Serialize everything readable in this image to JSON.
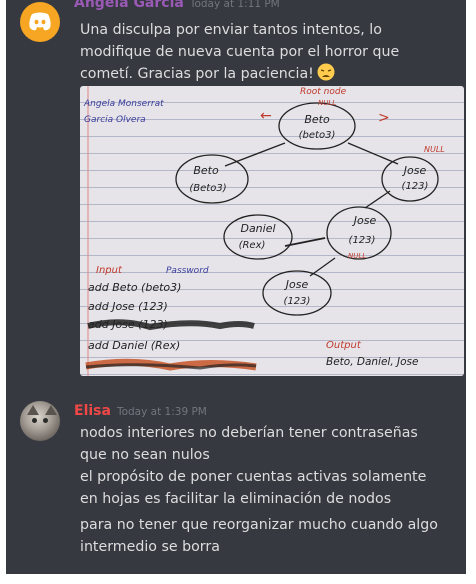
{
  "messages": [
    {
      "author": "Angela Garcia",
      "author_color": "#9b59b6",
      "timestamp": "Today at 1:11 PM",
      "lines": [
        "Una disculpa por enviar tantos intentos, lo",
        "modifique de nueva cuenta por el horror que",
        "cometí.   Gracias por la paciencia!"
      ],
      "emoji": "weary-face-emoji",
      "avatar": "discord-logo-icon",
      "attachment": {
        "notes_top_left": [
          "Angela Monserrat",
          "Garcia Olvera"
        ],
        "root_note": [
          "Root node",
          "NULL"
        ],
        "arrow_left": "←",
        "arrow_right": ">",
        "null_right": "NULL",
        "null_jose": "NULL",
        "nodes": [
          {
            "name": "Beto",
            "pass": "(beto3)"
          },
          {
            "name": "Beto",
            "pass": "(Beto3)"
          },
          {
            "name": "Jose",
            "pass": "(123)"
          },
          {
            "name": "Daniel",
            "pass": "(Rex)"
          },
          {
            "name": "Jose",
            "pass": "(123)"
          },
          {
            "name": "Jose",
            "pass": "(123)"
          }
        ],
        "input_header": "Input",
        "password_header": "Password",
        "input_lines": [
          "add Beto (beto3)",
          "add Jose (123)",
          "add Jose (123)",
          "add Daniel (Rex)"
        ],
        "output_header": "Output",
        "output_value": "Beto, Daniel, Jose"
      }
    },
    {
      "author": "Elisa",
      "author_color": "#f04747",
      "timestamp": "Today at 1:39 PM",
      "avatar": "cat-avatar",
      "lines": [
        "nodos interiores no deberían tener contraseñas",
        "que no sean nulos"
      ],
      "lines2": [
        "el propósito de poner cuentas activas solamente",
        "en hojas es facilitar la eliminación de nodos"
      ],
      "lines3": [
        "para no tener que reorganizar mucho cuando algo",
        "intermedio se borra"
      ]
    }
  ]
}
